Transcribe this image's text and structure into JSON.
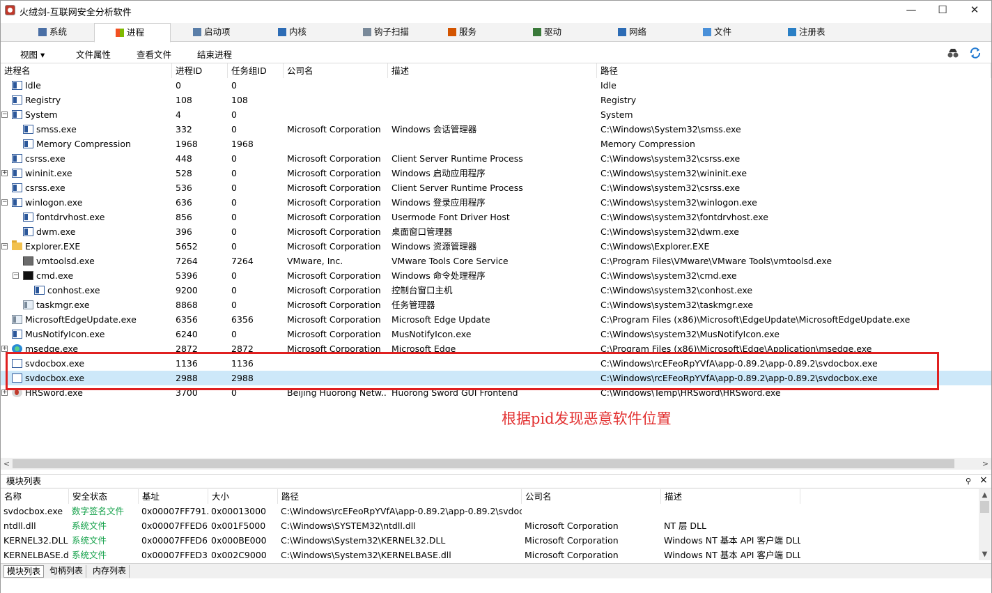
{
  "window": {
    "title": "火绒剑-互联网安全分析软件",
    "min": "—",
    "max": "☐",
    "close": "✕"
  },
  "tabs": [
    {
      "label": "系统",
      "icon": "system-icon"
    },
    {
      "label": "进程",
      "icon": "windows-flag-icon",
      "active": true
    },
    {
      "label": "启动项",
      "icon": "startup-icon"
    },
    {
      "label": "内核",
      "icon": "kernel-icon"
    },
    {
      "label": "钩子扫描",
      "icon": "hook-icon"
    },
    {
      "label": "服务",
      "icon": "service-icon"
    },
    {
      "label": "驱动",
      "icon": "driver-icon"
    },
    {
      "label": "网络",
      "icon": "network-icon"
    },
    {
      "label": "文件",
      "icon": "file-icon"
    },
    {
      "label": "注册表",
      "icon": "registry-icon"
    }
  ],
  "toolbar": {
    "view": "视图 ▾",
    "file_props": "文件属性",
    "view_file": "查看文件",
    "end_process": "结束进程"
  },
  "columns": [
    "进程名",
    "进程ID",
    "任务组ID",
    "公司名",
    "描述",
    "路径"
  ],
  "processes": [
    {
      "name": "Idle",
      "pid": "0",
      "tgid": "0",
      "company": "",
      "desc": "",
      "path": "Idle",
      "indent": 0,
      "exp": "",
      "icon": "app"
    },
    {
      "name": "Registry",
      "pid": "108",
      "tgid": "108",
      "company": "",
      "desc": "",
      "path": "Registry",
      "indent": 0,
      "exp": "",
      "icon": "app"
    },
    {
      "name": "System",
      "pid": "4",
      "tgid": "0",
      "company": "",
      "desc": "",
      "path": "System",
      "indent": 0,
      "exp": "−",
      "icon": "app"
    },
    {
      "name": "smss.exe",
      "pid": "332",
      "tgid": "0",
      "company": "Microsoft Corporation",
      "desc": "Windows 会话管理器",
      "path": "C:\\Windows\\System32\\smss.exe",
      "indent": 1,
      "exp": "",
      "icon": "app"
    },
    {
      "name": "Memory Compression",
      "pid": "1968",
      "tgid": "1968",
      "company": "",
      "desc": "",
      "path": "Memory Compression",
      "indent": 1,
      "exp": "",
      "icon": "app"
    },
    {
      "name": "csrss.exe",
      "pid": "448",
      "tgid": "0",
      "company": "Microsoft Corporation",
      "desc": "Client Server Runtime Process",
      "path": "C:\\Windows\\system32\\csrss.exe",
      "indent": 0,
      "exp": "",
      "icon": "app"
    },
    {
      "name": "wininit.exe",
      "pid": "528",
      "tgid": "0",
      "company": "Microsoft Corporation",
      "desc": "Windows 启动应用程序",
      "path": "C:\\Windows\\system32\\wininit.exe",
      "indent": 0,
      "exp": "+",
      "icon": "app"
    },
    {
      "name": "csrss.exe",
      "pid": "536",
      "tgid": "0",
      "company": "Microsoft Corporation",
      "desc": "Client Server Runtime Process",
      "path": "C:\\Windows\\system32\\csrss.exe",
      "indent": 0,
      "exp": "",
      "icon": "app"
    },
    {
      "name": "winlogon.exe",
      "pid": "636",
      "tgid": "0",
      "company": "Microsoft Corporation",
      "desc": "Windows 登录应用程序",
      "path": "C:\\Windows\\system32\\winlogon.exe",
      "indent": 0,
      "exp": "−",
      "icon": "app"
    },
    {
      "name": "fontdrvhost.exe",
      "pid": "856",
      "tgid": "0",
      "company": "Microsoft Corporation",
      "desc": "Usermode Font Driver Host",
      "path": "C:\\Windows\\system32\\fontdrvhost.exe",
      "indent": 1,
      "exp": "",
      "icon": "app"
    },
    {
      "name": "dwm.exe",
      "pid": "396",
      "tgid": "0",
      "company": "Microsoft Corporation",
      "desc": "桌面窗口管理器",
      "path": "C:\\Windows\\system32\\dwm.exe",
      "indent": 1,
      "exp": "",
      "icon": "app"
    },
    {
      "name": "Explorer.EXE",
      "pid": "5652",
      "tgid": "0",
      "company": "Microsoft Corporation",
      "desc": "Windows 资源管理器",
      "path": "C:\\Windows\\Explorer.EXE",
      "indent": 0,
      "exp": "−",
      "icon": "folder"
    },
    {
      "name": "vmtoolsd.exe",
      "pid": "7264",
      "tgid": "7264",
      "company": "VMware, Inc.",
      "desc": "VMware Tools Core Service",
      "path": "C:\\Program Files\\VMware\\VMware Tools\\vmtoolsd.exe",
      "indent": 1,
      "exp": "",
      "icon": "vm"
    },
    {
      "name": "cmd.exe",
      "pid": "5396",
      "tgid": "0",
      "company": "Microsoft Corporation",
      "desc": "Windows 命令处理程序",
      "path": "C:\\Windows\\system32\\cmd.exe",
      "indent": 1,
      "exp": "−",
      "icon": "cmd"
    },
    {
      "name": "conhost.exe",
      "pid": "9200",
      "tgid": "0",
      "company": "Microsoft Corporation",
      "desc": "控制台窗口主机",
      "path": "C:\\Windows\\system32\\conhost.exe",
      "indent": 2,
      "exp": "",
      "icon": "app"
    },
    {
      "name": "taskmgr.exe",
      "pid": "8868",
      "tgid": "0",
      "company": "Microsoft Corporation",
      "desc": "任务管理器",
      "path": "C:\\Windows\\system32\\taskmgr.exe",
      "indent": 1,
      "exp": "",
      "icon": "task"
    },
    {
      "name": "MicrosoftEdgeUpdate.exe",
      "pid": "6356",
      "tgid": "6356",
      "company": "Microsoft Corporation",
      "desc": "Microsoft Edge Update",
      "path": "C:\\Program Files (x86)\\Microsoft\\EdgeUpdate\\MicrosoftEdgeUpdate.exe",
      "indent": 0,
      "exp": "",
      "icon": "task"
    },
    {
      "name": "MusNotifyIcon.exe",
      "pid": "6240",
      "tgid": "0",
      "company": "Microsoft Corporation",
      "desc": "MusNotifyIcon.exe",
      "path": "C:\\Windows\\system32\\MusNotifyIcon.exe",
      "indent": 0,
      "exp": "",
      "icon": "app"
    },
    {
      "name": "msedge.exe",
      "pid": "2872",
      "tgid": "2872",
      "company": "Microsoft Corporation",
      "desc": "Microsoft Edge",
      "path": "C:\\Program Files (x86)\\Microsoft\\Edge\\Application\\msedge.exe",
      "indent": 0,
      "exp": "+",
      "icon": "edge"
    },
    {
      "name": "svdocbox.exe",
      "pid": "1136",
      "tgid": "1136",
      "company": "",
      "desc": "",
      "path": "C:\\Windows\\rcEFeoRpYVfA\\app-0.89.2\\app-0.89.2\\svdocbox.exe",
      "indent": 0,
      "exp": "",
      "icon": "plain"
    },
    {
      "name": "svdocbox.exe",
      "pid": "2988",
      "tgid": "2988",
      "company": "",
      "desc": "",
      "path": "C:\\Windows\\rcEFeoRpYVfA\\app-0.89.2\\app-0.89.2\\svdocbox.exe",
      "indent": 0,
      "exp": "",
      "icon": "plain",
      "selected": true
    },
    {
      "name": "HRSword.exe",
      "pid": "3700",
      "tgid": "0",
      "company": "Beijing Huorong Netw...",
      "desc": "Huorong Sword GUI Frontend",
      "path": "C:\\Windows\\Temp\\HRSword\\HRSword.exe",
      "indent": 0,
      "exp": "+",
      "icon": "hr"
    }
  ],
  "annotation": "根据pid发现恶意软件位置",
  "highlight_color": "#e02020",
  "modules": {
    "title": "模块列表",
    "columns": [
      "名称",
      "安全状态",
      "基址",
      "大小",
      "路径",
      "公司名",
      "描述"
    ],
    "rows": [
      {
        "name": "svdocbox.exe",
        "status": "数字签名文件",
        "base": "0x00007FF791...",
        "size": "0x00013000",
        "path": "C:\\Windows\\rcEFeoRpYVfA\\app-0.89.2\\app-0.89.2\\svdoc...",
        "company": "",
        "desc": ""
      },
      {
        "name": "ntdll.dll",
        "status": "系统文件",
        "base": "0x00007FFED6...",
        "size": "0x001F5000",
        "path": "C:\\Windows\\SYSTEM32\\ntdll.dll",
        "company": "Microsoft Corporation",
        "desc": "NT 层 DLL"
      },
      {
        "name": "KERNEL32.DLL",
        "status": "系统文件",
        "base": "0x00007FFED6...",
        "size": "0x000BE000",
        "path": "C:\\Windows\\System32\\KERNEL32.DLL",
        "company": "Microsoft Corporation",
        "desc": "Windows NT 基本 API 客户端 DLL"
      },
      {
        "name": "KERNELBASE.dll",
        "status": "系统文件",
        "base": "0x00007FFED3...",
        "size": "0x002C9000",
        "path": "C:\\Windows\\System32\\KERNELBASE.dll",
        "company": "Microsoft Corporation",
        "desc": "Windows NT 基本 API 客户端 DLL"
      }
    ]
  },
  "bottom_tabs": [
    "模块列表",
    "句柄列表",
    "内存列表"
  ]
}
